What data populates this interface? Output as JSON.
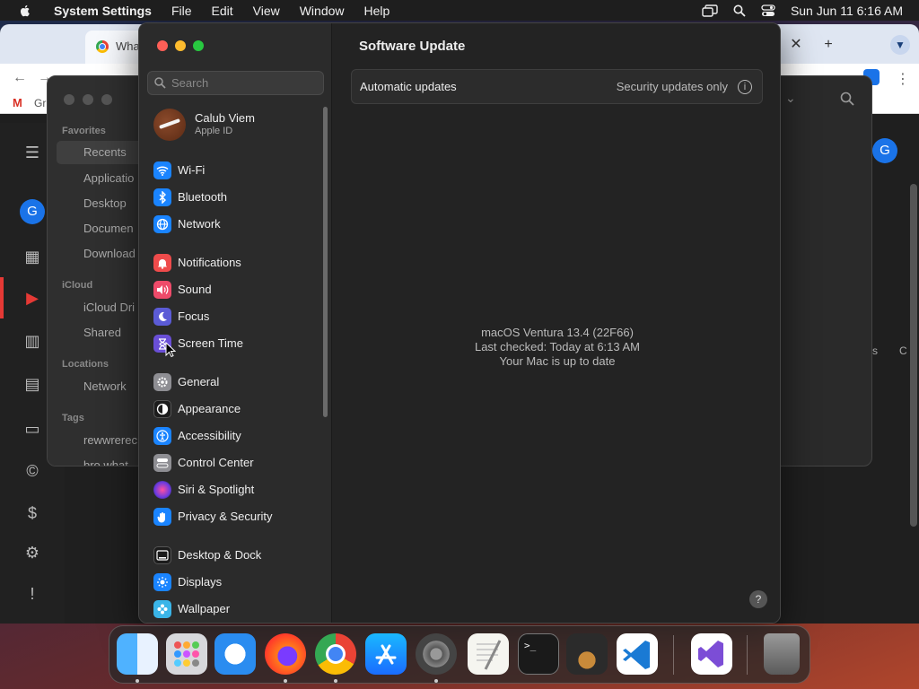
{
  "menubar": {
    "app_name": "System Settings",
    "menus": [
      "File",
      "Edit",
      "View",
      "Window",
      "Help"
    ],
    "datetime": "Sun Jun 11  6:16 AM"
  },
  "chrome": {
    "tab_title": "Wha",
    "bookmark_label": "Gr",
    "avatar_letter": "G"
  },
  "finder": {
    "favorites_header": "Favorites",
    "favorites": [
      "Recents",
      "Applicatio",
      "Desktop",
      "Documen",
      "Download"
    ],
    "icloud_header": "iCloud",
    "icloud": [
      "iCloud Dri",
      "Shared"
    ],
    "locations_header": "Locations",
    "locations": [
      "Network"
    ],
    "tags_header": "Tags",
    "tags": [
      "rewwrerec",
      "bro what"
    ],
    "right_labels": [
      "s",
      "C"
    ]
  },
  "settings": {
    "search_placeholder": "Search",
    "account": {
      "name": "Calub Viem",
      "subtitle": "Apple ID"
    },
    "sidebar_items": [
      {
        "label": "Wi-Fi",
        "icon": "wifi-icon",
        "color": "#1a84ff"
      },
      {
        "label": "Bluetooth",
        "icon": "bluetooth-icon",
        "color": "#1a84ff"
      },
      {
        "label": "Network",
        "icon": "globe-icon",
        "color": "#1a84ff"
      },
      {
        "label": "Notifications",
        "icon": "bell-icon",
        "color": "#ee4b4b"
      },
      {
        "label": "Sound",
        "icon": "speaker-icon",
        "color": "#ee4b6a"
      },
      {
        "label": "Focus",
        "icon": "moon-icon",
        "color": "#5b5bd6"
      },
      {
        "label": "Screen Time",
        "icon": "hourglass-icon",
        "color": "#6a4fd6"
      },
      {
        "label": "General",
        "icon": "gear-icon",
        "color": "#8e8e93"
      },
      {
        "label": "Appearance",
        "icon": "appearance-icon",
        "color": "#1c1c1c"
      },
      {
        "label": "Accessibility",
        "icon": "accessibility-icon",
        "color": "#1a84ff"
      },
      {
        "label": "Control Center",
        "icon": "toggles-icon",
        "color": "#8e8e93"
      },
      {
        "label": "Siri & Spotlight",
        "icon": "siri-icon",
        "color": "#b23acb"
      },
      {
        "label": "Privacy & Security",
        "icon": "hand-icon",
        "color": "#1a84ff"
      },
      {
        "label": "Desktop & Dock",
        "icon": "dock-icon",
        "color": "#1c1c1c"
      },
      {
        "label": "Displays",
        "icon": "sun-icon",
        "color": "#1a84ff"
      },
      {
        "label": "Wallpaper",
        "icon": "flower-icon",
        "color": "#3ab5e8"
      }
    ],
    "main": {
      "title": "Software Update",
      "auto_updates_label": "Automatic updates",
      "auto_updates_value": "Security updates only",
      "info_glyph": "i",
      "status_lines": [
        "macOS Ventura 13.4 (22F66)",
        "Last checked: Today at 6:13 AM",
        "Your Mac is up to date"
      ],
      "help_glyph": "?"
    }
  },
  "dock": {
    "apps": [
      "Finder",
      "Launchpad",
      "Safari",
      "Firefox",
      "Chrome",
      "App Store",
      "System Settings",
      "TextEdit",
      "Terminal",
      "GarageBand",
      "Visual Studio Code",
      "Visual Studio",
      "Trash"
    ],
    "terminal_prompt": ">_"
  }
}
